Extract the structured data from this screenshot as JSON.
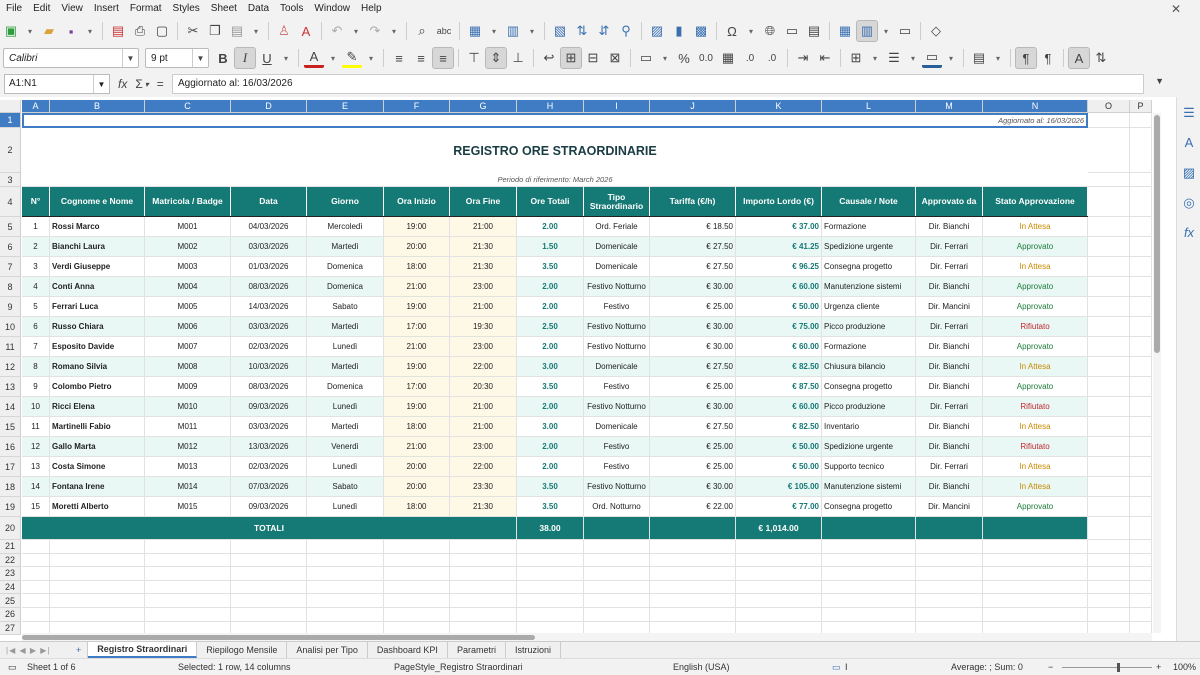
{
  "menu": [
    "File",
    "Edit",
    "View",
    "Insert",
    "Format",
    "Styles",
    "Sheet",
    "Data",
    "Tools",
    "Window",
    "Help"
  ],
  "toolbar": {
    "font_name": "Calibri",
    "font_size": "9 pt"
  },
  "formula_bar": {
    "cell_ref": "A1:N1",
    "content": "Aggiornato al: 16/03/2026",
    "fx": "fx",
    "sum": "Σ",
    "eq": "="
  },
  "columns": [
    "A",
    "B",
    "C",
    "D",
    "E",
    "F",
    "G",
    "H",
    "I",
    "J",
    "K",
    "L",
    "M",
    "N",
    "O",
    "P"
  ],
  "sheet": {
    "updated": "Aggiornato al: 16/03/2026",
    "title": "REGISTRO ORE STRAORDINARIE",
    "period": "Periodo di riferimento: March 2026",
    "headers": [
      "N°",
      "Cognome e Nome",
      "Matricola / Badge",
      "Data",
      "Giorno",
      "Ora Inizio",
      "Ora Fine",
      "Ore Totali",
      "Tipo Straordinario",
      "Tariffa (€/h)",
      "Importo Lordo (€)",
      "Causale / Note",
      "Approvato da",
      "Stato Approvazione"
    ],
    "rows": [
      [
        "1",
        "Rossi Marco",
        "M001",
        "04/03/2026",
        "Mercoledì",
        "19:00",
        "21:00",
        "2.00",
        "Ord. Feriale",
        "€ 18.50",
        "€ 37.00",
        "Formazione",
        "Dir. Bianchi",
        "In Attesa"
      ],
      [
        "2",
        "Bianchi Laura",
        "M002",
        "03/03/2026",
        "Martedì",
        "20:00",
        "21:30",
        "1.50",
        "Domenicale",
        "€ 27.50",
        "€ 41.25",
        "Spedizione urgente",
        "Dir. Ferrari",
        "Approvato"
      ],
      [
        "3",
        "Verdi Giuseppe",
        "M003",
        "01/03/2026",
        "Domenica",
        "18:00",
        "21:30",
        "3.50",
        "Domenicale",
        "€ 27.50",
        "€ 96.25",
        "Consegna progetto",
        "Dir. Ferrari",
        "In Attesa"
      ],
      [
        "4",
        "Conti Anna",
        "M004",
        "08/03/2026",
        "Domenica",
        "21:00",
        "23:00",
        "2.00",
        "Festivo Notturno",
        "€ 30.00",
        "€ 60.00",
        "Manutenzione sistemi",
        "Dir. Bianchi",
        "Approvato"
      ],
      [
        "5",
        "Ferrari Luca",
        "M005",
        "14/03/2026",
        "Sabato",
        "19:00",
        "21:00",
        "2.00",
        "Festivo",
        "€ 25.00",
        "€ 50.00",
        "Urgenza cliente",
        "Dir. Mancini",
        "Approvato"
      ],
      [
        "6",
        "Russo Chiara",
        "M006",
        "03/03/2026",
        "Martedì",
        "17:00",
        "19:30",
        "2.50",
        "Festivo Notturno",
        "€ 30.00",
        "€ 75.00",
        "Picco produzione",
        "Dir. Ferrari",
        "Rifiutato"
      ],
      [
        "7",
        "Esposito Davide",
        "M007",
        "02/03/2026",
        "Lunedì",
        "21:00",
        "23:00",
        "2.00",
        "Festivo Notturno",
        "€ 30.00",
        "€ 60.00",
        "Formazione",
        "Dir. Bianchi",
        "Approvato"
      ],
      [
        "8",
        "Romano Silvia",
        "M008",
        "10/03/2026",
        "Martedì",
        "19:00",
        "22:00",
        "3.00",
        "Domenicale",
        "€ 27.50",
        "€ 82.50",
        "Chiusura bilancio",
        "Dir. Bianchi",
        "In Attesa"
      ],
      [
        "9",
        "Colombo Pietro",
        "M009",
        "08/03/2026",
        "Domenica",
        "17:00",
        "20:30",
        "3.50",
        "Festivo",
        "€ 25.00",
        "€ 87.50",
        "Consegna progetto",
        "Dir. Bianchi",
        "Approvato"
      ],
      [
        "10",
        "Ricci Elena",
        "M010",
        "09/03/2026",
        "Lunedì",
        "19:00",
        "21:00",
        "2.00",
        "Festivo Notturno",
        "€ 30.00",
        "€ 60.00",
        "Picco produzione",
        "Dir. Ferrari",
        "Rifiutato"
      ],
      [
        "11",
        "Martinelli Fabio",
        "M011",
        "03/03/2026",
        "Martedì",
        "18:00",
        "21:00",
        "3.00",
        "Domenicale",
        "€ 27.50",
        "€ 82.50",
        "Inventario",
        "Dir. Bianchi",
        "In Attesa"
      ],
      [
        "12",
        "Gallo Marta",
        "M012",
        "13/03/2026",
        "Venerdì",
        "21:00",
        "23:00",
        "2.00",
        "Festivo",
        "€ 25.00",
        "€ 50.00",
        "Spedizione urgente",
        "Dir. Bianchi",
        "Rifiutato"
      ],
      [
        "13",
        "Costa Simone",
        "M013",
        "02/03/2026",
        "Lunedì",
        "20:00",
        "22:00",
        "2.00",
        "Festivo",
        "€ 25.00",
        "€ 50.00",
        "Supporto tecnico",
        "Dir. Ferrari",
        "In Attesa"
      ],
      [
        "14",
        "Fontana Irene",
        "M014",
        "07/03/2026",
        "Sabato",
        "20:00",
        "23:30",
        "3.50",
        "Festivo Notturno",
        "€ 30.00",
        "€ 105.00",
        "Manutenzione sistemi",
        "Dir. Bianchi",
        "In Attesa"
      ],
      [
        "15",
        "Moretti Alberto",
        "M015",
        "09/03/2026",
        "Lunedì",
        "18:00",
        "21:30",
        "3.50",
        "Ord. Notturno",
        "€ 22.00",
        "€ 77.00",
        "Consegna progetto",
        "Dir. Mancini",
        "Approvato"
      ]
    ],
    "totals": {
      "label": "TOTALI",
      "hours": "38.00",
      "amount": "€ 1,014.00"
    }
  },
  "tabs": [
    "Registro Straordinari",
    "Riepilogo Mensile",
    "Analisi per Tipo",
    "Dashboard KPI",
    "Parametri",
    "Istruzioni"
  ],
  "tab_add": "+",
  "status": {
    "sheet": "Sheet 1 of 6",
    "selection": "Selected: 1 row, 14 columns",
    "page_style": "PageStyle_Registro Straordinari",
    "language": "English (USA)",
    "stats": "Average: ; Sum: 0",
    "zoom": "100%"
  },
  "colors": {
    "header": "#157a75",
    "approved": "#d4f1dd",
    "pending": "#fff3c4",
    "rejected": "#fbd9d9",
    "selection": "#3f7cc4"
  }
}
